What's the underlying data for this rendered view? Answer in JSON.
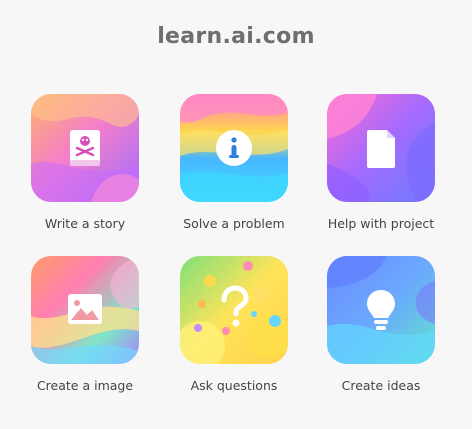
{
  "site": {
    "title": "learn.ai.com"
  },
  "apps": [
    {
      "label": "Write a story",
      "icon": "book-skull-icon"
    },
    {
      "label": "Solve a problem",
      "icon": "info-icon"
    },
    {
      "label": "Help with project",
      "icon": "document-icon"
    },
    {
      "label": "Create a image",
      "icon": "image-icon"
    },
    {
      "label": "Ask questions",
      "icon": "question-mark-icon"
    },
    {
      "label": "Create ideas",
      "icon": "lightbulb-icon"
    }
  ]
}
